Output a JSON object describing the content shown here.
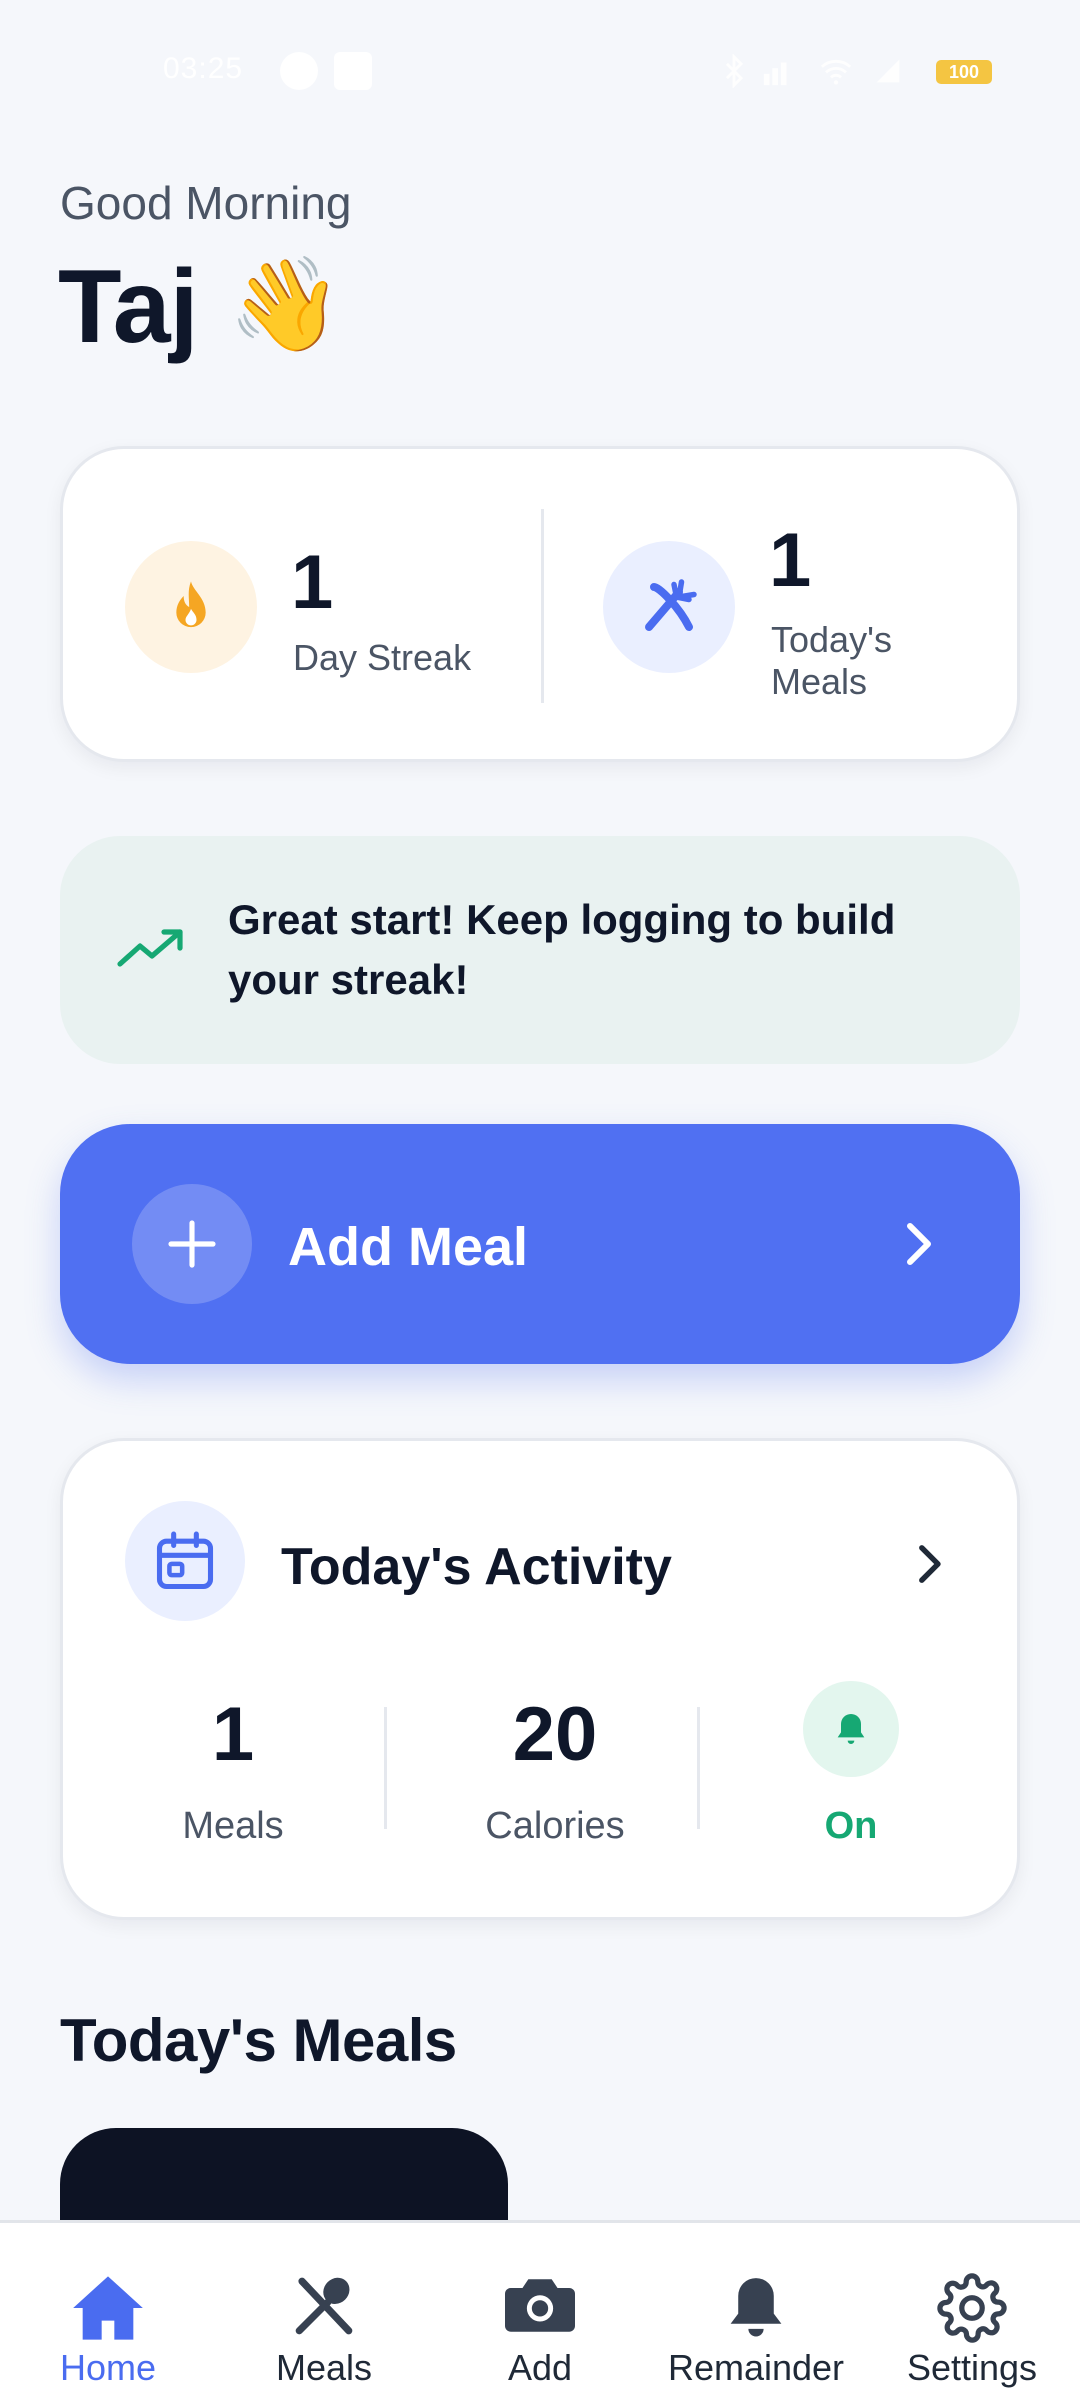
{
  "status_bar": {
    "time": "03:25",
    "battery": "100"
  },
  "header": {
    "greeting": "Good Morning",
    "name": "Taj",
    "wave_emoji": "👋"
  },
  "stats": {
    "streak": {
      "value": "1",
      "label": "Day Streak",
      "icon": "flame-icon",
      "color": "#f5a623"
    },
    "meals": {
      "value": "1",
      "label_line1": "Today's",
      "label_line2": "Meals",
      "icon": "fork-knife-icon",
      "color": "#4a6cf0"
    }
  },
  "streak_message": {
    "text": "Great start! Keep logging to build your streak!",
    "icon": "trending-up-icon",
    "color": "#16a873"
  },
  "add_meal": {
    "label": "Add Meal",
    "color": "#5070f2"
  },
  "activity": {
    "title": "Today's Activity",
    "meals": {
      "value": "1",
      "label": "Meals"
    },
    "calories": {
      "value": "20",
      "label": "Calories"
    },
    "reminder": {
      "label": "On",
      "icon": "bell-icon",
      "color": "#16a873"
    }
  },
  "meals_section": {
    "title": "Today's Meals"
  },
  "bottom_nav": {
    "active_color": "#4a6cf0",
    "items": [
      {
        "label": "Home",
        "icon": "home-icon"
      },
      {
        "label": "Meals",
        "icon": "utensils-icon"
      },
      {
        "label": "Add",
        "icon": "camera-icon"
      },
      {
        "label": "Remainder",
        "icon": "bell-icon"
      },
      {
        "label": "Settings",
        "icon": "gear-icon"
      }
    ]
  }
}
